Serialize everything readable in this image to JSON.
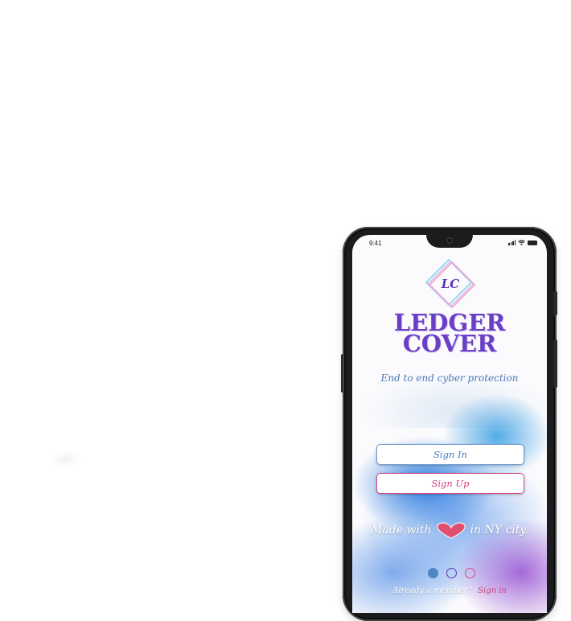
{
  "status_bar": {
    "time": "9:41"
  },
  "logo": {
    "monogram": "LC"
  },
  "brand": {
    "line1": "LEDGER",
    "line2": "COVER"
  },
  "tagline": "End to end cyber protection",
  "buttons": {
    "sign_in": "Sign In",
    "sign_up": "Sign Up"
  },
  "footer_note": {
    "before": "Made with",
    "after": "in NY city."
  },
  "pager": {
    "count": 3,
    "active_index": 0
  },
  "member_prompt": {
    "text": "Already a member?",
    "link": "Sign in"
  },
  "colors": {
    "brand_purple": "#6a3fc6",
    "accent_pink": "#d23c7e",
    "accent_blue": "#4577b6"
  }
}
